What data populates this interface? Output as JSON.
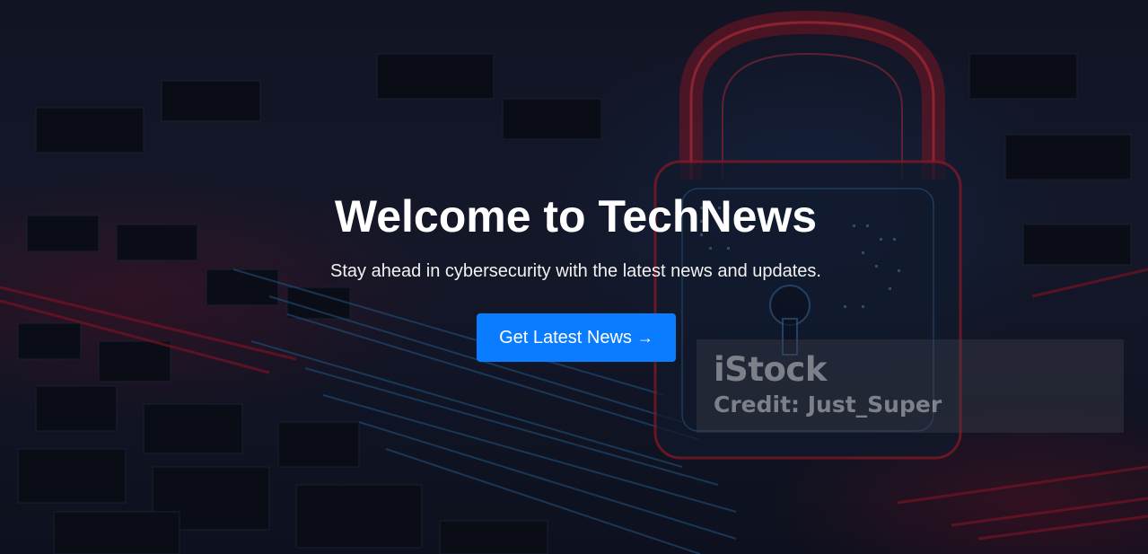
{
  "hero": {
    "title": "Welcome to TechNews",
    "subtitle": "Stay ahead in cybersecurity with the latest news and updates.",
    "cta_label": "Get Latest News",
    "cta_arrow": "→"
  },
  "watermark": {
    "brand": "iStock",
    "credit": "Credit: Just_Super"
  },
  "colors": {
    "accent": "#0a7cff",
    "text": "#ffffff",
    "lock_glow": "#c8202c",
    "circuit_blue": "#2f7fbf"
  }
}
